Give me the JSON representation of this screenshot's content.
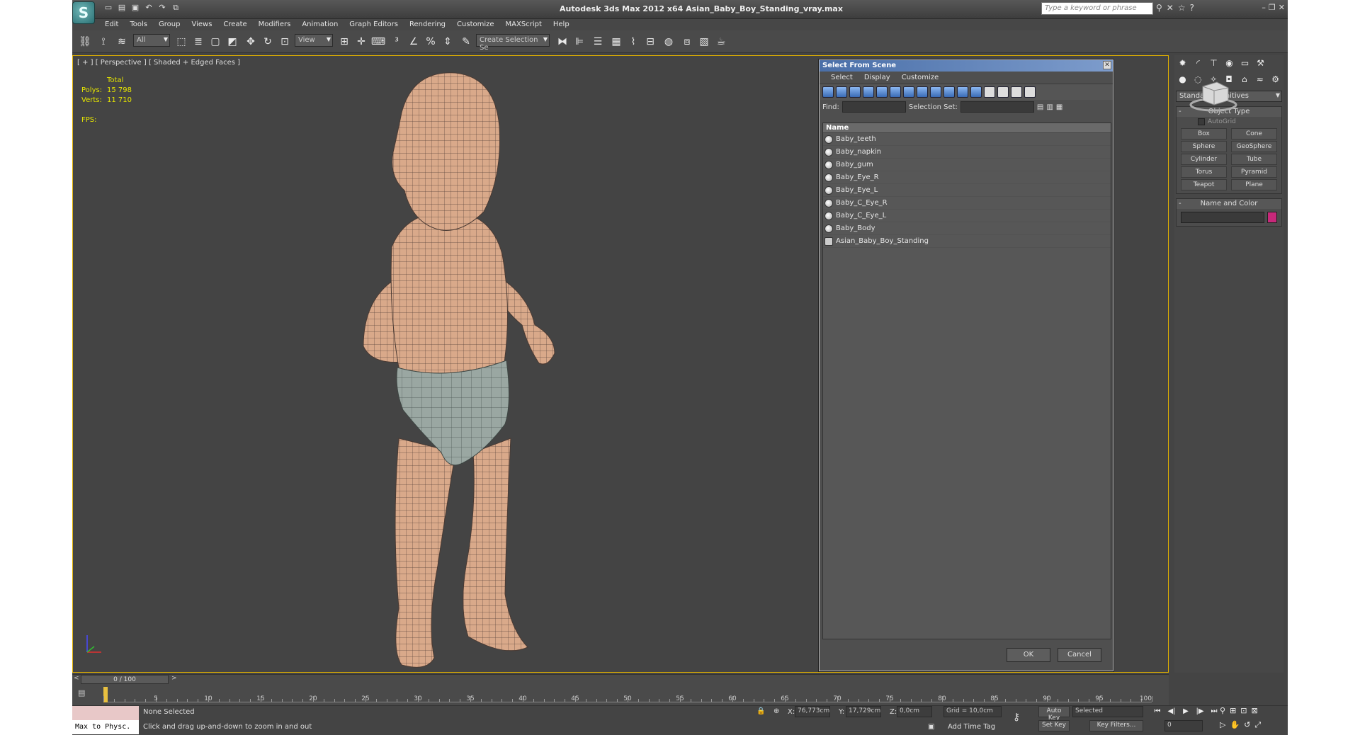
{
  "app": {
    "title": "Autodesk 3ds Max  2012 x64     Asian_Baby_Boy_Standing_vray.max",
    "search_placeholder": "Type a keyword or phrase"
  },
  "menu": [
    "Edit",
    "Tools",
    "Group",
    "Views",
    "Create",
    "Modifiers",
    "Animation",
    "Graph Editors",
    "Rendering",
    "Customize",
    "MAXScript",
    "Help"
  ],
  "toolbar": {
    "filter": "All",
    "refcoord": "View",
    "selset": "Create Selection Se"
  },
  "viewport": {
    "label": "[ + ] [ Perspective ] [ Shaded + Edged Faces ]",
    "total": "Total",
    "polys_label": "Polys:",
    "polys": "15 798",
    "verts_label": "Verts:",
    "verts": "11 710",
    "fps": "FPS:"
  },
  "dialog": {
    "title": "Select From Scene",
    "menu": [
      "Select",
      "Display",
      "Customize"
    ],
    "find": "Find:",
    "selset": "Selection Set:",
    "header": "Name",
    "items": [
      "Baby_teeth",
      "Baby_napkin",
      "Baby_gum",
      "Baby_Eye_R",
      "Baby_Eye_L",
      "Baby_C_Eye_R",
      "Baby_C_Eye_L",
      "Baby_Body",
      "Asian_Baby_Boy_Standing"
    ],
    "ok": "OK",
    "cancel": "Cancel"
  },
  "command": {
    "dropdown": "Standard Primitives",
    "object_type": "Object Type",
    "autogrid": "AutoGrid",
    "buttons": [
      "Box",
      "Cone",
      "Sphere",
      "GeoSphere",
      "Cylinder",
      "Tube",
      "Torus",
      "Pyramid",
      "Teapot",
      "Plane"
    ],
    "name_color": "Name and Color",
    "color": "#c8287a"
  },
  "time": {
    "slider": "0 / 100",
    "frame_progress": 0.0,
    "ticks": [
      "5",
      "10",
      "15",
      "20",
      "25",
      "30",
      "35",
      "40",
      "45",
      "50",
      "55",
      "60",
      "65",
      "70",
      "75",
      "80",
      "85",
      "90",
      "95",
      "100"
    ]
  },
  "status": {
    "maxscript": "Max to Physc.",
    "selected": "None Selected",
    "hint": "Click and drag up-and-down to zoom in and out",
    "x_label": "X:",
    "x": "76,773cm",
    "y_label": "Y:",
    "y": "17,729cm",
    "z_label": "Z:",
    "z": "0,0cm",
    "grid": "Grid = 10,0cm",
    "autokey": "Auto Key",
    "setkey": "Set Key",
    "key_mode": "Selected",
    "key_filters": "Key Filters...",
    "time_tag": "Add Time Tag",
    "frame": "0"
  }
}
